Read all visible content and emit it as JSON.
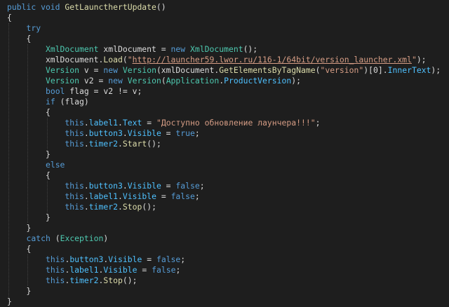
{
  "editor": {
    "lines": [
      [
        [
          "kw",
          "public void "
        ],
        [
          "mt",
          "GetLauncthertUpdate"
        ],
        [
          "tx",
          "()"
        ]
      ],
      [
        [
          "tx",
          "{"
        ]
      ],
      [
        [
          "tx",
          "    "
        ],
        [
          "kw",
          "try"
        ]
      ],
      [
        [
          "tx",
          "    {"
        ]
      ],
      [
        [
          "tx",
          "        "
        ],
        [
          "ty",
          "XmlDocument"
        ],
        [
          "tx",
          " xmlDocument = "
        ],
        [
          "kw",
          "new "
        ],
        [
          "ty",
          "XmlDocument"
        ],
        [
          "tx",
          "();"
        ]
      ],
      [
        [
          "tx",
          "        xmlDocument."
        ],
        [
          "mt",
          "Load"
        ],
        [
          "tx",
          "("
        ],
        [
          "st",
          "\""
        ],
        [
          "ln",
          "http://launcher59.lwor.ru/116-1/64bit/version_launcher.xml"
        ],
        [
          "st",
          "\""
        ],
        [
          "tx",
          ");"
        ]
      ],
      [
        [
          "tx",
          "        "
        ],
        [
          "ty",
          "Version"
        ],
        [
          "tx",
          " v = "
        ],
        [
          "kw",
          "new "
        ],
        [
          "ty",
          "Version"
        ],
        [
          "tx",
          "(xmlDocument."
        ],
        [
          "mt",
          "GetElementsByTagName"
        ],
        [
          "tx",
          "("
        ],
        [
          "st",
          "\"version\""
        ],
        [
          "tx",
          ")[0]."
        ],
        [
          "pr",
          "InnerText"
        ],
        [
          "tx",
          ");"
        ]
      ],
      [
        [
          "tx",
          "        "
        ],
        [
          "ty",
          "Version"
        ],
        [
          "tx",
          " v2 = "
        ],
        [
          "kw",
          "new "
        ],
        [
          "ty",
          "Version"
        ],
        [
          "tx",
          "("
        ],
        [
          "ty",
          "Application"
        ],
        [
          "tx",
          "."
        ],
        [
          "pr",
          "ProductVersion"
        ],
        [
          "tx",
          ");"
        ]
      ],
      [
        [
          "tx",
          "        "
        ],
        [
          "kw",
          "bool"
        ],
        [
          "tx",
          " flag = v2 != v;"
        ]
      ],
      [
        [
          "tx",
          "        "
        ],
        [
          "kw",
          "if"
        ],
        [
          "tx",
          " (flag)"
        ]
      ],
      [
        [
          "tx",
          "        {"
        ]
      ],
      [
        [
          "tx",
          "            "
        ],
        [
          "kw",
          "this"
        ],
        [
          "tx",
          "."
        ],
        [
          "pr",
          "label1"
        ],
        [
          "tx",
          "."
        ],
        [
          "pr",
          "Text"
        ],
        [
          "tx",
          " = "
        ],
        [
          "st",
          "\"Доступно обновление лаунчера!!!\""
        ],
        [
          "tx",
          ";"
        ]
      ],
      [
        [
          "tx",
          "            "
        ],
        [
          "kw",
          "this"
        ],
        [
          "tx",
          "."
        ],
        [
          "pr",
          "button3"
        ],
        [
          "tx",
          "."
        ],
        [
          "pr",
          "Visible"
        ],
        [
          "tx",
          " = "
        ],
        [
          "kw",
          "true"
        ],
        [
          "tx",
          ";"
        ]
      ],
      [
        [
          "tx",
          "            "
        ],
        [
          "kw",
          "this"
        ],
        [
          "tx",
          "."
        ],
        [
          "pr",
          "timer2"
        ],
        [
          "tx",
          "."
        ],
        [
          "mt",
          "Start"
        ],
        [
          "tx",
          "();"
        ]
      ],
      [
        [
          "tx",
          "        }"
        ]
      ],
      [
        [
          "tx",
          "        "
        ],
        [
          "kw",
          "else"
        ]
      ],
      [
        [
          "tx",
          "        {"
        ]
      ],
      [
        [
          "tx",
          "            "
        ],
        [
          "kw",
          "this"
        ],
        [
          "tx",
          "."
        ],
        [
          "pr",
          "button3"
        ],
        [
          "tx",
          "."
        ],
        [
          "pr",
          "Visible"
        ],
        [
          "tx",
          " = "
        ],
        [
          "kw",
          "false"
        ],
        [
          "tx",
          ";"
        ]
      ],
      [
        [
          "tx",
          "            "
        ],
        [
          "kw",
          "this"
        ],
        [
          "tx",
          "."
        ],
        [
          "pr",
          "label1"
        ],
        [
          "tx",
          "."
        ],
        [
          "pr",
          "Visible"
        ],
        [
          "tx",
          " = "
        ],
        [
          "kw",
          "false"
        ],
        [
          "tx",
          ";"
        ]
      ],
      [
        [
          "tx",
          "            "
        ],
        [
          "kw",
          "this"
        ],
        [
          "tx",
          "."
        ],
        [
          "pr",
          "timer2"
        ],
        [
          "tx",
          "."
        ],
        [
          "mt",
          "Stop"
        ],
        [
          "tx",
          "();"
        ]
      ],
      [
        [
          "tx",
          "        }"
        ]
      ],
      [
        [
          "tx",
          "    }"
        ]
      ],
      [
        [
          "tx",
          "    "
        ],
        [
          "kw",
          "catch"
        ],
        [
          "tx",
          " ("
        ],
        [
          "ty",
          "Exception"
        ],
        [
          "tx",
          ")"
        ]
      ],
      [
        [
          "tx",
          "    {"
        ]
      ],
      [
        [
          "tx",
          "        "
        ],
        [
          "kw",
          "this"
        ],
        [
          "tx",
          "."
        ],
        [
          "pr",
          "button3"
        ],
        [
          "tx",
          "."
        ],
        [
          "pr",
          "Visible"
        ],
        [
          "tx",
          " = "
        ],
        [
          "kw",
          "false"
        ],
        [
          "tx",
          ";"
        ]
      ],
      [
        [
          "tx",
          "        "
        ],
        [
          "kw",
          "this"
        ],
        [
          "tx",
          "."
        ],
        [
          "pr",
          "label1"
        ],
        [
          "tx",
          "."
        ],
        [
          "pr",
          "Visible"
        ],
        [
          "tx",
          " = "
        ],
        [
          "kw",
          "false"
        ],
        [
          "tx",
          ";"
        ]
      ],
      [
        [
          "tx",
          "        "
        ],
        [
          "kw",
          "this"
        ],
        [
          "tx",
          "."
        ],
        [
          "pr",
          "timer2"
        ],
        [
          "tx",
          "."
        ],
        [
          "mt",
          "Stop"
        ],
        [
          "tx",
          "();"
        ]
      ],
      [
        [
          "tx",
          "    }"
        ]
      ],
      [
        [
          "tx",
          "}"
        ]
      ]
    ]
  }
}
